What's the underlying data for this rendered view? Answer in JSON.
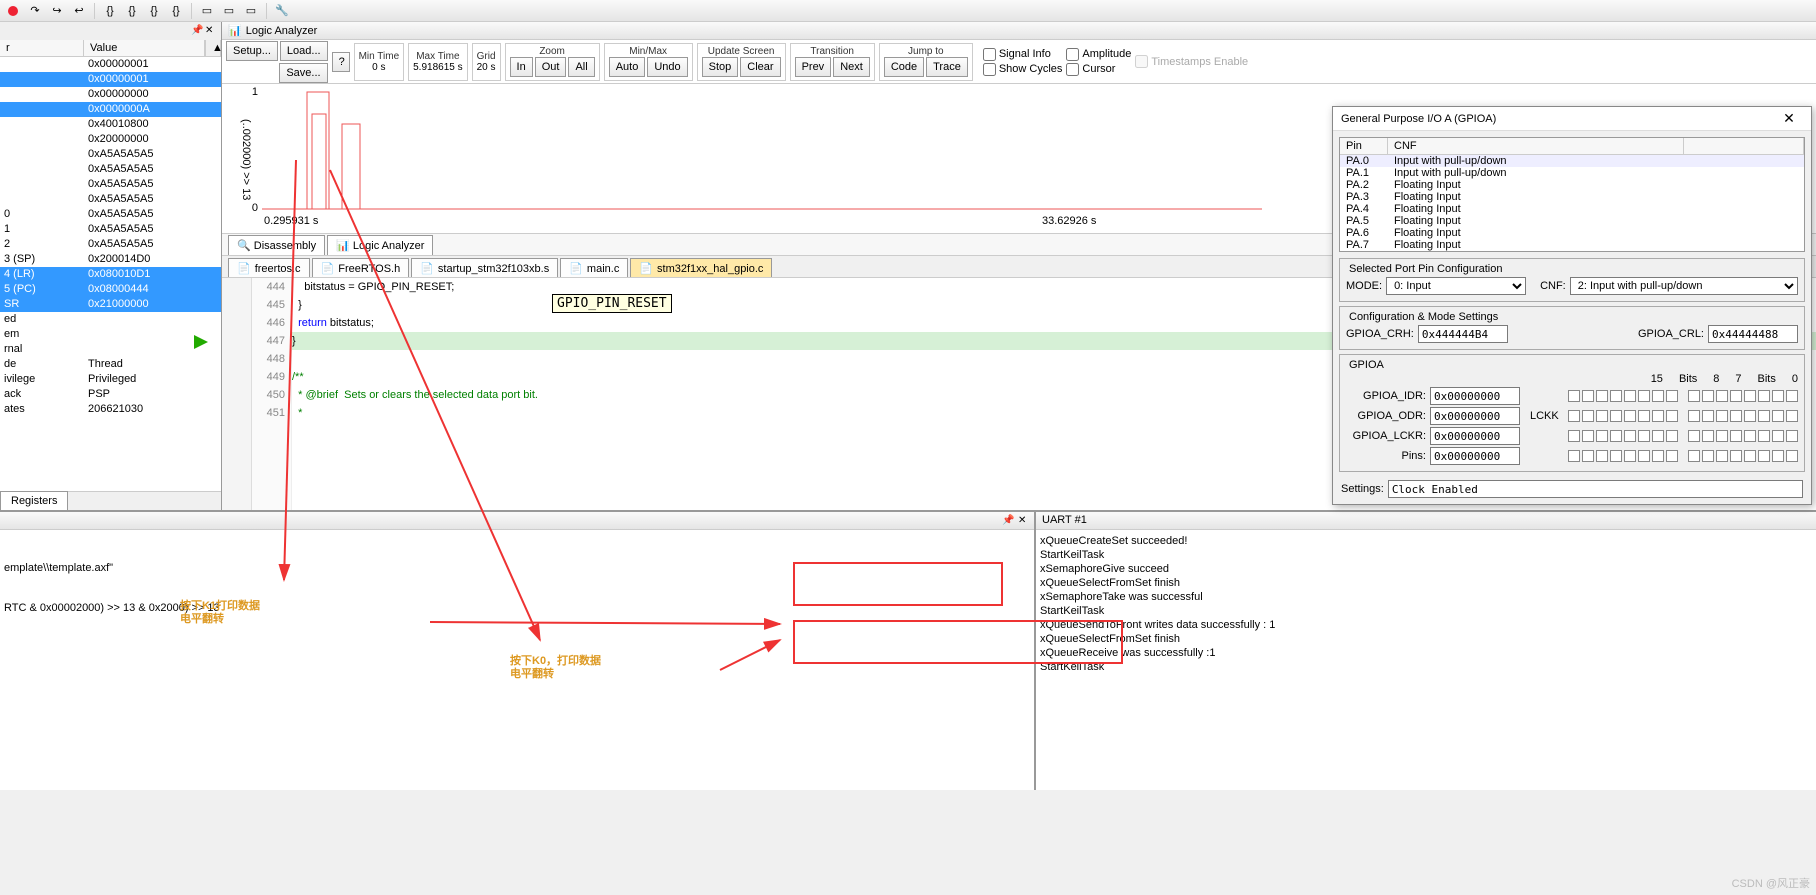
{
  "toolbar_icons": [
    "stop",
    "step",
    "step",
    "step",
    "sep",
    "braces",
    "braces",
    "braces",
    "braces",
    "sep",
    "a",
    "b",
    "sep",
    "mag"
  ],
  "registers": {
    "headers": [
      "r",
      "Value"
    ],
    "rows": [
      {
        "name": "",
        "val": "0x00000001",
        "sel": false
      },
      {
        "name": "",
        "val": "0x00000001",
        "sel": true
      },
      {
        "name": "",
        "val": "0x00000000",
        "sel": false
      },
      {
        "name": "",
        "val": "0x0000000A",
        "sel": true
      },
      {
        "name": "",
        "val": "0x40010800",
        "sel": false
      },
      {
        "name": "",
        "val": "0x20000000",
        "sel": false
      },
      {
        "name": "",
        "val": "0xA5A5A5A5",
        "sel": false
      },
      {
        "name": "",
        "val": "0xA5A5A5A5",
        "sel": false
      },
      {
        "name": "",
        "val": "0xA5A5A5A5",
        "sel": false
      },
      {
        "name": "",
        "val": "0xA5A5A5A5",
        "sel": false
      },
      {
        "name": "0",
        "val": "0xA5A5A5A5",
        "sel": false
      },
      {
        "name": "1",
        "val": "0xA5A5A5A5",
        "sel": false
      },
      {
        "name": "2",
        "val": "0xA5A5A5A5",
        "sel": false
      },
      {
        "name": "3 (SP)",
        "val": "0x200014D0",
        "sel": false
      },
      {
        "name": "4 (LR)",
        "val": "0x080010D1",
        "sel": true
      },
      {
        "name": "5 (PC)",
        "val": "0x08000444",
        "sel": true
      },
      {
        "name": "SR",
        "val": "0x21000000",
        "sel": true
      },
      {
        "name": "ed",
        "val": "",
        "sel": false
      },
      {
        "name": "em",
        "val": "",
        "sel": false
      },
      {
        "name": "rnal",
        "val": "",
        "sel": false
      },
      {
        "name": "de",
        "val": "Thread",
        "sel": false
      },
      {
        "name": "ivilege",
        "val": "Privileged",
        "sel": false
      },
      {
        "name": "ack",
        "val": "PSP",
        "sel": false
      },
      {
        "name": "ates",
        "val": "206621030",
        "sel": false
      }
    ],
    "tab": "Registers"
  },
  "la": {
    "title": "Logic Analyzer",
    "setup": "Setup...",
    "load": "Load...",
    "save": "Save...",
    "mintime_l": "Min Time",
    "mintime_v": "0 s",
    "maxtime_l": "Max Time",
    "maxtime_v": "5.918615 s",
    "grid_l": "Grid",
    "grid_v": "20 s",
    "zoom_l": "Zoom",
    "zoom_in": "In",
    "zoom_out": "Out",
    "zoom_all": "All",
    "minmax_l": "Min/Max",
    "mm_auto": "Auto",
    "mm_undo": "Undo",
    "update_l": "Update Screen",
    "us_stop": "Stop",
    "us_clear": "Clear",
    "trans_l": "Transition",
    "tr_prev": "Prev",
    "tr_next": "Next",
    "jump_l": "Jump to",
    "jp_code": "Code",
    "jp_trace": "Trace",
    "sig": "Signal Info",
    "cyc": "Show Cycles",
    "amp": "Amplitude",
    "cur": "Cursor",
    "ts": "Timestamps Enable",
    "ylabel": "(..002000) >> 13",
    "t_left": "0.295931 s",
    "t_right": "33.62926 s"
  },
  "analyzer_tabs": {
    "dis": "Disassembly",
    "la": "Logic Analyzer"
  },
  "file_tabs": [
    "freertos.c",
    "FreeRTOS.h",
    "startup_stm32f103xb.s",
    "main.c",
    "stm32f1xx_hal_gpio.c"
  ],
  "code": {
    "start": 444,
    "lines": [
      "    bitstatus = GPIO_PIN_RESET;",
      "  }",
      "  return bitstatus;",
      "}",
      "",
      "/**",
      "  * @brief  Sets or clears the selected data port bit.",
      "  *"
    ],
    "tooltip": "GPIO_PIN_RESET"
  },
  "console": {
    "l1": "emplate\\\\template.axf\"",
    "l2": "RTC & 0x00002000) >> 13 & 0x2000) >> 13"
  },
  "uart": {
    "title": "UART #1",
    "lines": [
      "xQueueCreateSet succeeded!",
      "StartKeilTask",
      "xSemaphoreGive succeed",
      "xQueueSelectFromSet finish",
      "xSemaphoreTake was successful",
      "StartKeilTask",
      "xQueueSendToFront writes data successfully : 1",
      "xQueueSelectFromSet finish",
      "xQueueReceive was successfully :1",
      "StartKeilTask"
    ]
  },
  "gpio": {
    "title": "General Purpose I/O A (GPIOA)",
    "hdr": [
      "Pin",
      "CNF"
    ],
    "pins": [
      {
        "p": "PA.0",
        "c": "Input with pull-up/down"
      },
      {
        "p": "PA.1",
        "c": "Input with pull-up/down"
      },
      {
        "p": "PA.2",
        "c": "Floating Input"
      },
      {
        "p": "PA.3",
        "c": "Floating Input"
      },
      {
        "p": "PA.4",
        "c": "Floating Input"
      },
      {
        "p": "PA.5",
        "c": "Floating Input"
      },
      {
        "p": "PA.6",
        "c": "Floating Input"
      },
      {
        "p": "PA.7",
        "c": "Floating Input"
      }
    ],
    "sel_legend": "Selected Port Pin Configuration",
    "mode_l": "MODE:",
    "mode_v": "0: Input",
    "cnf_l": "CNF:",
    "cnf_v": "2: Input with pull-up/down",
    "cfg_legend": "Configuration & Mode Settings",
    "crh_l": "GPIOA_CRH:",
    "crh_v": "0x444444B4",
    "crl_l": "GPIOA_CRL:",
    "crl_v": "0x44444488",
    "gpioa_legend": "GPIOA",
    "idr_l": "GPIOA_IDR:",
    "idr_v": "0x00000000",
    "odr_l": "GPIOA_ODR:",
    "odr_v": "0x00000000",
    "lckr_l": "GPIOA_LCKR:",
    "lckr_v": "0x00000000",
    "pins_l": "Pins:",
    "pins_v": "0x00000000",
    "lckk": "LCKK",
    "bits_l1": "15",
    "bits_l2": "Bits",
    "bits_l3": "8",
    "bits_l4": "7",
    "bits_l5": "Bits",
    "bits_l6": "0",
    "set_l": "Settings:",
    "set_v": "Clock Enabled"
  },
  "annot": {
    "k1a": "按下K1打印数据",
    "k1b": "电平翻转",
    "k0a": "按下K0，打印数据",
    "k0b": "电平翻转"
  },
  "watermark": "CSDN @风正豪"
}
